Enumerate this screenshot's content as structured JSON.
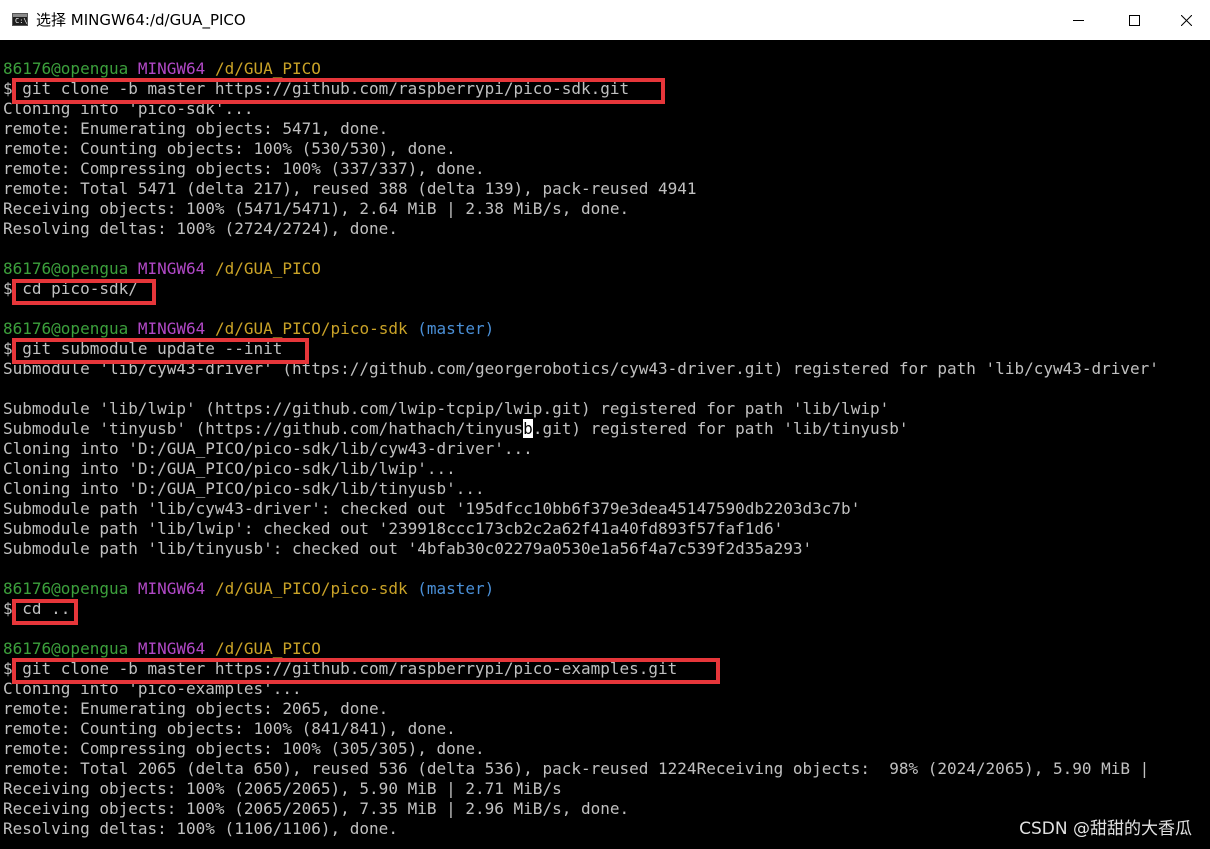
{
  "window": {
    "title": "选择 MINGW64:/d/GUA_PICO",
    "icon": "console-icon",
    "icon_glyph": "C:\\",
    "controls": [
      "minimize-icon",
      "maximize-icon",
      "close-icon"
    ]
  },
  "colors": {
    "user": "#3ca03c",
    "host": "#b148c6",
    "path": "#c9a227",
    "branch": "#4a8fd6",
    "text": "#c0c0c0",
    "highlight": "#e6363a"
  },
  "terminal": {
    "lines": [
      {
        "type": "prompt",
        "user": "86176@opengua",
        "host": "MINGW64",
        "path": "/d/GUA_PICO",
        "branch": ""
      },
      {
        "type": "text",
        "text": "$ git clone -b master https://github.com/raspberrypi/pico-sdk.git"
      },
      {
        "type": "text",
        "text": "Cloning into 'pico-sdk'..."
      },
      {
        "type": "text",
        "text": "remote: Enumerating objects: 5471, done."
      },
      {
        "type": "text",
        "text": "remote: Counting objects: 100% (530/530), done."
      },
      {
        "type": "text",
        "text": "remote: Compressing objects: 100% (337/337), done."
      },
      {
        "type": "text",
        "text": "remote: Total 5471 (delta 217), reused 388 (delta 139), pack-reused 4941"
      },
      {
        "type": "text",
        "text": "Receiving objects: 100% (5471/5471), 2.64 MiB | 2.38 MiB/s, done."
      },
      {
        "type": "text",
        "text": "Resolving deltas: 100% (2724/2724), done."
      },
      {
        "type": "blank",
        "text": ""
      },
      {
        "type": "prompt",
        "user": "86176@opengua",
        "host": "MINGW64",
        "path": "/d/GUA_PICO",
        "branch": ""
      },
      {
        "type": "text",
        "text": "$ cd pico-sdk/"
      },
      {
        "type": "blank",
        "text": ""
      },
      {
        "type": "prompt",
        "user": "86176@opengua",
        "host": "MINGW64",
        "path": "/d/GUA_PICO/pico-sdk",
        "branch": "(master)"
      },
      {
        "type": "text",
        "text": "$ git submodule update --init"
      },
      {
        "type": "text",
        "text": "Submodule 'lib/cyw43-driver' (https://github.com/georgerobotics/cyw43-driver.git) registered for path 'lib/cyw43-driver'"
      },
      {
        "type": "blank",
        "text": ""
      },
      {
        "type": "text",
        "text": "Submodule 'lib/lwip' (https://github.com/lwip-tcpip/lwip.git) registered for path 'lib/lwip'"
      },
      {
        "type": "cursor",
        "before": "Submodule 'tinyusb' (https://github.com/hathach/tinyus",
        "cursor": "b",
        "after": ".git) registered for path 'lib/tinyusb'"
      },
      {
        "type": "text",
        "text": "Cloning into 'D:/GUA_PICO/pico-sdk/lib/cyw43-driver'..."
      },
      {
        "type": "text",
        "text": "Cloning into 'D:/GUA_PICO/pico-sdk/lib/lwip'..."
      },
      {
        "type": "text",
        "text": "Cloning into 'D:/GUA_PICO/pico-sdk/lib/tinyusb'..."
      },
      {
        "type": "text",
        "text": "Submodule path 'lib/cyw43-driver': checked out '195dfcc10bb6f379e3dea45147590db2203d3c7b'"
      },
      {
        "type": "text",
        "text": "Submodule path 'lib/lwip': checked out '239918ccc173cb2c2a62f41a40fd893f57faf1d6'"
      },
      {
        "type": "text",
        "text": "Submodule path 'lib/tinyusb': checked out '4bfab30c02279a0530e1a56f4a7c539f2d35a293'"
      },
      {
        "type": "blank",
        "text": ""
      },
      {
        "type": "prompt",
        "user": "86176@opengua",
        "host": "MINGW64",
        "path": "/d/GUA_PICO/pico-sdk",
        "branch": "(master)"
      },
      {
        "type": "text",
        "text": "$ cd .."
      },
      {
        "type": "blank",
        "text": ""
      },
      {
        "type": "prompt",
        "user": "86176@opengua",
        "host": "MINGW64",
        "path": "/d/GUA_PICO",
        "branch": ""
      },
      {
        "type": "text",
        "text": "$ git clone -b master https://github.com/raspberrypi/pico-examples.git"
      },
      {
        "type": "text",
        "text": "Cloning into 'pico-examples'..."
      },
      {
        "type": "text",
        "text": "remote: Enumerating objects: 2065, done."
      },
      {
        "type": "text",
        "text": "remote: Counting objects: 100% (841/841), done."
      },
      {
        "type": "text",
        "text": "remote: Compressing objects: 100% (305/305), done."
      },
      {
        "type": "text",
        "text": "remote: Total 2065 (delta 650), reused 536 (delta 536), pack-reused 1224Receiving objects:  98% (2024/2065), 5.90 MiB |"
      },
      {
        "type": "text",
        "text": "Receiving objects: 100% (2065/2065), 5.90 MiB | 2.71 MiB/s"
      },
      {
        "type": "text",
        "text": "Receiving objects: 100% (2065/2065), 7.35 MiB | 2.96 MiB/s, done."
      },
      {
        "type": "text",
        "text": "Resolving deltas: 100% (1106/1106), done."
      }
    ]
  },
  "watermark": "CSDN @甜甜的大香瓜"
}
